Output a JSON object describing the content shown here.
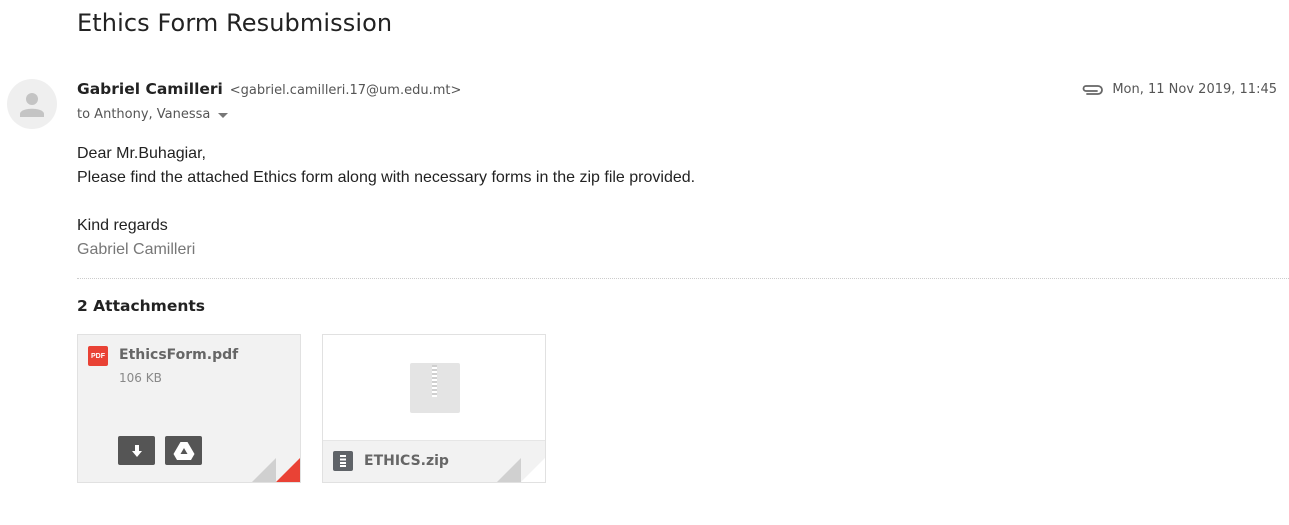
{
  "subject": "Ethics Form Resubmission",
  "sender": {
    "name": "Gabriel Camilleri",
    "email": "<gabriel.camilleri.17@um.edu.mt>",
    "to": "to Anthony, Vanessa"
  },
  "date": "Mon, 11 Nov 2019, 11:45",
  "body": {
    "greeting": "Dear Mr.Buhagiar,",
    "line1": "Please find the attached Ethics form along with necessary forms in the zip file provided.",
    "closing": "Kind regards",
    "signature": "Gabriel Camilleri"
  },
  "attachments": {
    "header": "2 Attachments",
    "items": [
      {
        "name": "EthicsForm.pdf",
        "size": "106 KB",
        "badge": "PDF",
        "icon": "pdf-icon"
      },
      {
        "name": "ETHICS.zip",
        "icon": "zip-file-icon"
      }
    ]
  },
  "colors": {
    "pdf_red": "#e94235",
    "button_dark": "#555555"
  },
  "icons": [
    "avatar-icon",
    "paperclip-icon",
    "chevron-down-icon",
    "download-icon",
    "google-drive-icon"
  ]
}
